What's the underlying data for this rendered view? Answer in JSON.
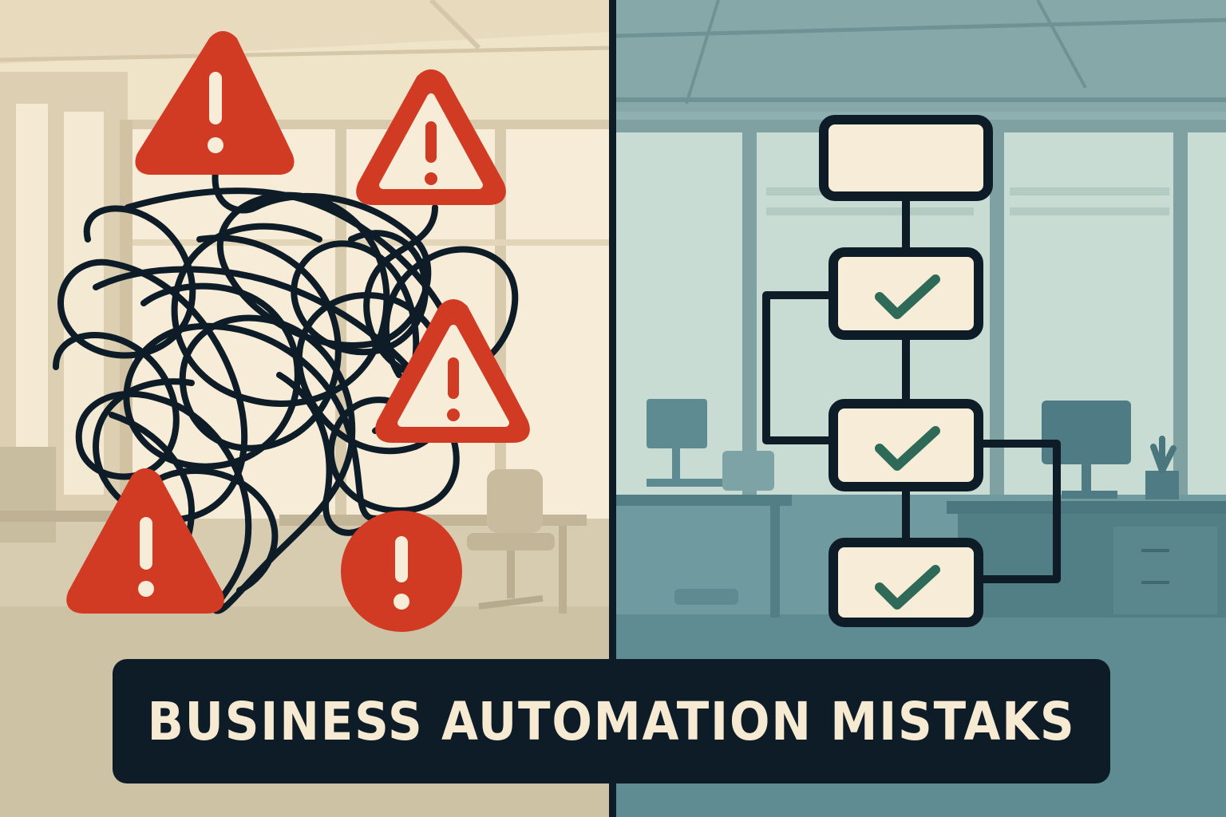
{
  "banner": {
    "text": "BUSINESS AUTOMATION MISTAKS"
  },
  "colors": {
    "left_background": "#efe3c8",
    "right_background": "#8fb0b0",
    "warning_red": "#d13a23",
    "ink_dark": "#0e1c28",
    "box_cream": "#f6ecd7",
    "check_green": "#2e6a57",
    "banner_text": "#f6ead3"
  },
  "icons": {
    "warnings": [
      "warning-triangle-icon",
      "warning-circle-icon"
    ],
    "checks": [
      "checkmark-icon"
    ],
    "tangle": "tangled-lines-icon",
    "flowchart": "flowchart-icon"
  }
}
